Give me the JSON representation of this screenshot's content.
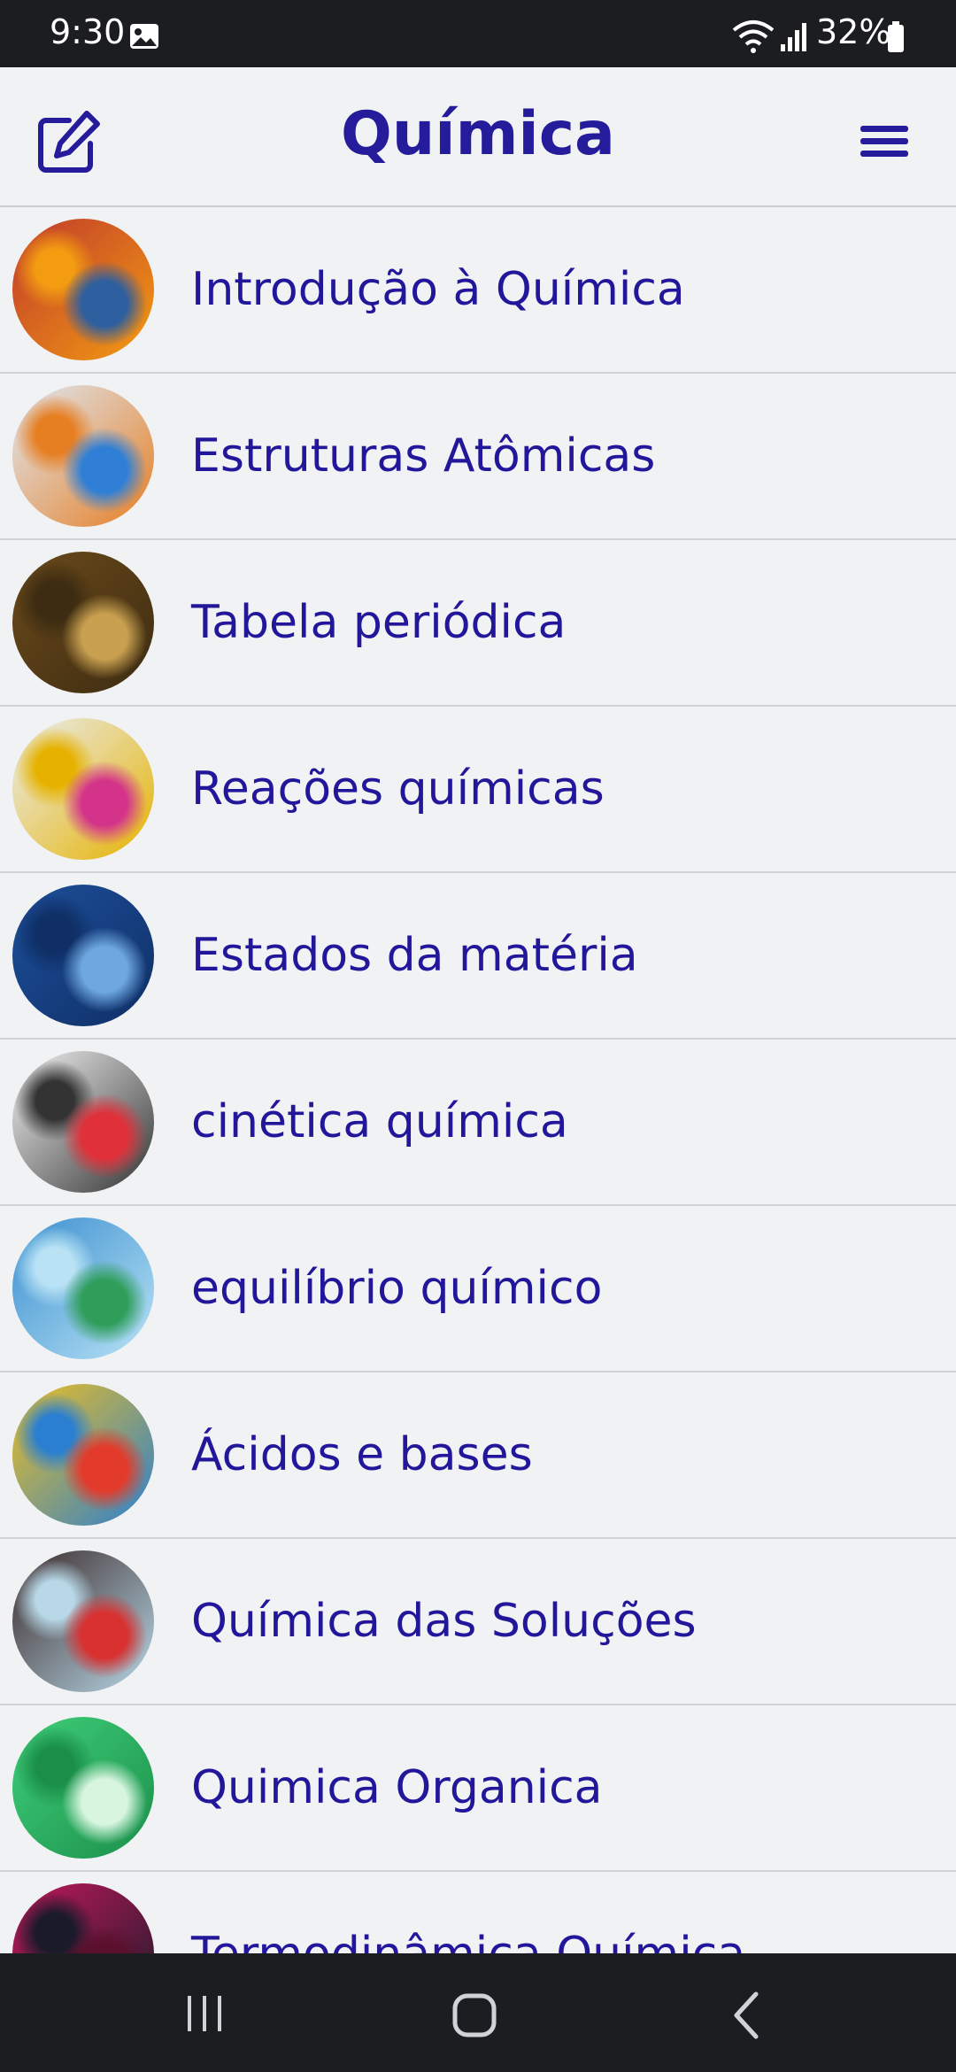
{
  "status_bar": {
    "time": "9:30",
    "battery": "32%"
  },
  "header": {
    "title": "Química"
  },
  "topics": [
    {
      "label": "Introdução à Química",
      "colors": [
        "#c0392b",
        "#2e5f9e",
        "#f39c12"
      ]
    },
    {
      "label": "Estruturas Atômicas",
      "colors": [
        "#dfe9f5",
        "#2f7fd6",
        "#e67e22"
      ]
    },
    {
      "label": "Tabela periódica",
      "colors": [
        "#6b4a1a",
        "#c8a050",
        "#3d2c12"
      ]
    },
    {
      "label": "Reações químicas",
      "colors": [
        "#e9eef2",
        "#d4338a",
        "#e6b200"
      ]
    },
    {
      "label": "Estados da matéria",
      "colors": [
        "#1d4f9a",
        "#6fa8e0",
        "#0f2f66"
      ]
    },
    {
      "label": "cinética química",
      "colors": [
        "#f4f4f4",
        "#e0303a",
        "#333333"
      ]
    },
    {
      "label": "equilíbrio químico",
      "colors": [
        "#3b8fd0",
        "#2f9e5a",
        "#b9e3f5"
      ]
    },
    {
      "label": "Ácidos e bases",
      "colors": [
        "#f0c020",
        "#e23b2c",
        "#2a7fd0"
      ]
    },
    {
      "label": "Química das Soluções",
      "colors": [
        "#3a2a2a",
        "#d93030",
        "#b8d8e8"
      ]
    },
    {
      "label": "Quimica Organica",
      "colors": [
        "#3fcf7a",
        "#d8f5e0",
        "#1b8f4a"
      ]
    },
    {
      "label": "Termodinâmica Química",
      "colors": [
        "#c2185b",
        "#5a0f2a",
        "#1a1a2a"
      ]
    }
  ]
}
